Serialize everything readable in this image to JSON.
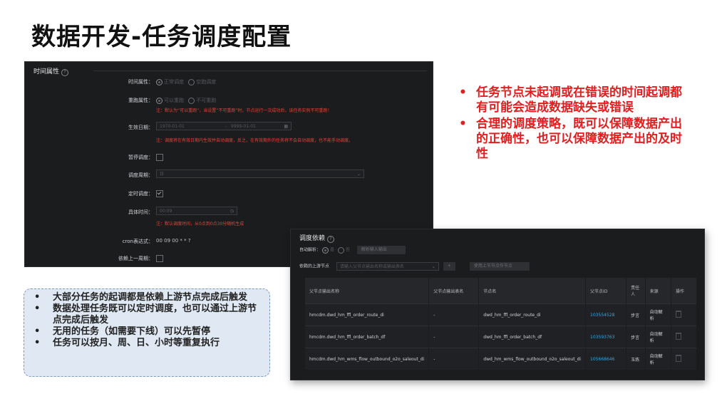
{
  "page_title": "数据开发-任务调度配置",
  "time_panel": {
    "section_title": "时间属性",
    "rows": [
      {
        "label": "时间属性：",
        "opt1": "正常调度",
        "opt2": "空跑调度"
      },
      {
        "label": "重跑属性：",
        "opt1": "可以重跑",
        "opt2": "不可重跑",
        "note": "注：默认为“可以重跑”，当设置“不可重跑”时，节点运行一次成功后，该任务实例不可重跑！"
      },
      {
        "label": "生效日期：",
        "start": "1970-01-01",
        "sep": "-",
        "end": "9999-01-01",
        "note": "注：调度将在有效日期内生效并自动调度，反之，在有效期外的任务将不会自动调度，也不能手动调度。"
      },
      {
        "label": "暂停调度："
      },
      {
        "label": "调度周期：",
        "value": "日"
      },
      {
        "label": "定时调度："
      },
      {
        "label": "具体时间：",
        "value": "00:09",
        "note": "注：默认调度时间，从0点到0点30分随机生成"
      },
      {
        "label": "cron表达式：",
        "value": "00 09 00 * * ?"
      },
      {
        "label": "依赖上一周期："
      }
    ]
  },
  "bullets_red": [
    "任务节点未起调或在错误的时间起调都有可能会造成数据缺失或错误",
    "合理的调度策略，既可以保障数据产出的正确性，也可以保障数据产出的及时性"
  ],
  "bullets_blue": [
    "大部分任务的起调都是依赖上游节点完成后触发",
    "数据处理任务既可以定时调度，也可以通过上游节点完成后触发",
    "无用的任务（如需要下线）可以先暂停",
    "任务可以按月、周、日、小时等重复执行"
  ],
  "dep_panel": {
    "section_title": "调度依赖",
    "auto_parse_label": "自动解析：",
    "auto_yes": "是",
    "auto_no": "否",
    "parse_button": "解析输入输出",
    "upstream_label": "依赖的上游节点",
    "upstream_placeholder": "请输入父节点输出名称或输出表名",
    "add_symbol": "+",
    "recommend_button": "使用上节节点作节点",
    "headers": [
      "父节点输出名称",
      "父节点输出表名",
      "节点名",
      "父节点ID",
      "责任人",
      "来源",
      "操作"
    ],
    "rows": [
      {
        "output": "hmcdm.dwd_hm_ffl_order_route_di",
        "table": "-",
        "node": "dwd_hm_ffl_order_route_di",
        "id": "103554528",
        "owner": "步言",
        "source": "自动解析"
      },
      {
        "output": "hmcdm.dwd_hm_ffl_order_batch_df",
        "table": "-",
        "node": "dwd_hm_ffl_order_batch_df",
        "id": "103593763",
        "owner": "步言",
        "source": "自动解析"
      },
      {
        "output": "hmcdm.dwd_hm_wms_flow_outbound_o2o_saleout_di",
        "table": "-",
        "node": "dwd_hm_wms_flow_outbound_o2o_saleout_di",
        "id": "105668646",
        "owner": "玉炼",
        "source": "自动解析"
      }
    ]
  },
  "colors": {
    "panel_bg": "#1b1c1e",
    "accent_red": "#e02020",
    "note_red": "#e2463a",
    "link_blue": "#2ea8e6",
    "note_box_bg": "#dfe8f3"
  }
}
